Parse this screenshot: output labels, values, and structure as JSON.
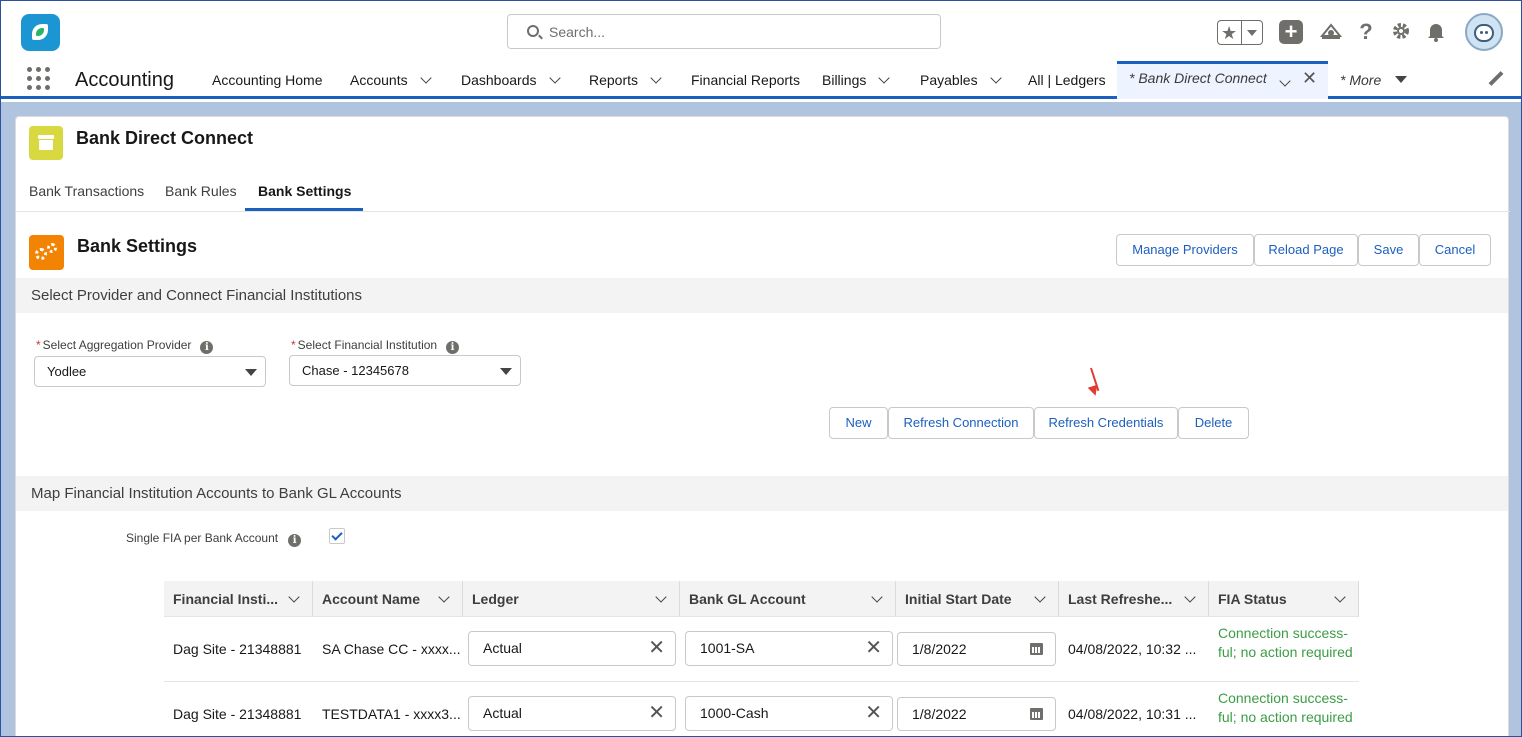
{
  "header": {
    "search_placeholder": "Search..."
  },
  "appnav": {
    "app_name": "Accounting",
    "items": [
      {
        "label": "Accounting Home"
      },
      {
        "label": "Accounts"
      },
      {
        "label": "Dashboards"
      },
      {
        "label": "Reports"
      },
      {
        "label": "Financial Reports"
      },
      {
        "label": "Billings"
      },
      {
        "label": "Payables"
      },
      {
        "label": "All | Ledgers"
      }
    ],
    "active_tab": "* Bank Direct Connect",
    "more": "* More"
  },
  "page": {
    "title": "Bank Direct Connect",
    "subtabs": [
      {
        "label": "Bank Transactions"
      },
      {
        "label": "Bank Rules"
      },
      {
        "label": "Bank Settings"
      }
    ]
  },
  "settings": {
    "title": "Bank Settings",
    "buttons": {
      "manage": "Manage Providers",
      "reload": "Reload Page",
      "save": "Save",
      "cancel": "Cancel"
    },
    "section1": "Select Provider and Connect Financial Institutions",
    "provider_label": "Select Aggregation Provider",
    "provider_value": "Yodlee",
    "institution_label": "Select Financial Institution",
    "institution_value": "Chase - 12345678",
    "conn_buttons": {
      "new": "New",
      "refresh_conn": "Refresh Connection",
      "refresh_cred": "Refresh Credentials",
      "delete": "Delete"
    },
    "section2": "Map Financial Institution Accounts to Bank GL Accounts",
    "single_fia_label": "Single FIA per Bank Account",
    "single_fia_checked": true
  },
  "table": {
    "columns": [
      "Financial Insti...",
      "Account Name",
      "Ledger",
      "Bank GL Account",
      "Initial Start Date",
      "Last Refreshe...",
      "FIA Status"
    ],
    "rows": [
      {
        "institution": "Dag Site - 21348881",
        "account": "SA Chase CC - xxxx...",
        "ledger": "Actual",
        "gl": "1001-SA",
        "start": "1/8/2022",
        "refreshed": "04/08/2022, 10:32 ...",
        "status": "Connection success-ful; no action required"
      },
      {
        "institution": "Dag Site - 21348881",
        "account": "TESTDATA1 - xxxx3...",
        "ledger": "Actual",
        "gl": "1000-Cash",
        "start": "1/8/2022",
        "refreshed": "04/08/2022, 10:31 ...",
        "status": "Connection success-ful; no action required"
      }
    ]
  }
}
